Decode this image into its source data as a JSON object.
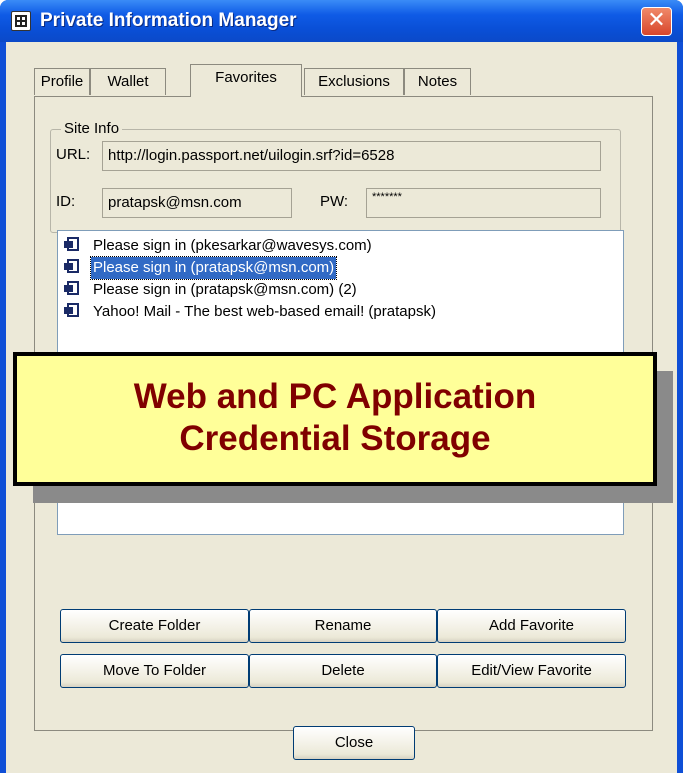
{
  "window": {
    "title": "Private Information Manager",
    "close_glyph": "✕"
  },
  "tabs": [
    {
      "label": "Profile"
    },
    {
      "label": "Wallet"
    },
    {
      "label": "Favorites"
    },
    {
      "label": "Exclusions"
    },
    {
      "label": "Notes"
    }
  ],
  "site_info": {
    "group_label": "Site Info",
    "url_label": "URL:",
    "url_value": "http://login.passport.net/uilogin.srf?id=6528",
    "id_label": "ID:",
    "id_value": "pratapsk@msn.com",
    "pw_label": "PW:",
    "pw_value": "*******"
  },
  "favorites_list": [
    {
      "label": "Please sign in (pkesarkar@wavesys.com)",
      "selected": false
    },
    {
      "label": "Please sign in (pratapsk@msn.com)",
      "selected": true
    },
    {
      "label": "Please sign in (pratapsk@msn.com) (2)",
      "selected": false
    },
    {
      "label": "Yahoo! Mail - The best web-based email! (pratapsk)",
      "selected": false
    }
  ],
  "buttons": {
    "create_folder": "Create Folder",
    "rename": "Rename",
    "add_favorite": "Add Favorite",
    "move_to_folder": "Move To Folder",
    "delete": "Delete",
    "edit_view_favorite": "Edit/View Favorite",
    "close": "Close"
  },
  "callout": {
    "line1": "Web and PC Application",
    "line2": "Credential Storage"
  },
  "colors": {
    "titlebar": "#0a4fd6",
    "selection": "#316ac5",
    "callout_bg": "#ffff99",
    "callout_text": "#800000"
  },
  "icons": {
    "app": "grid-app-icon",
    "list_item": "favorite-page-icon"
  }
}
